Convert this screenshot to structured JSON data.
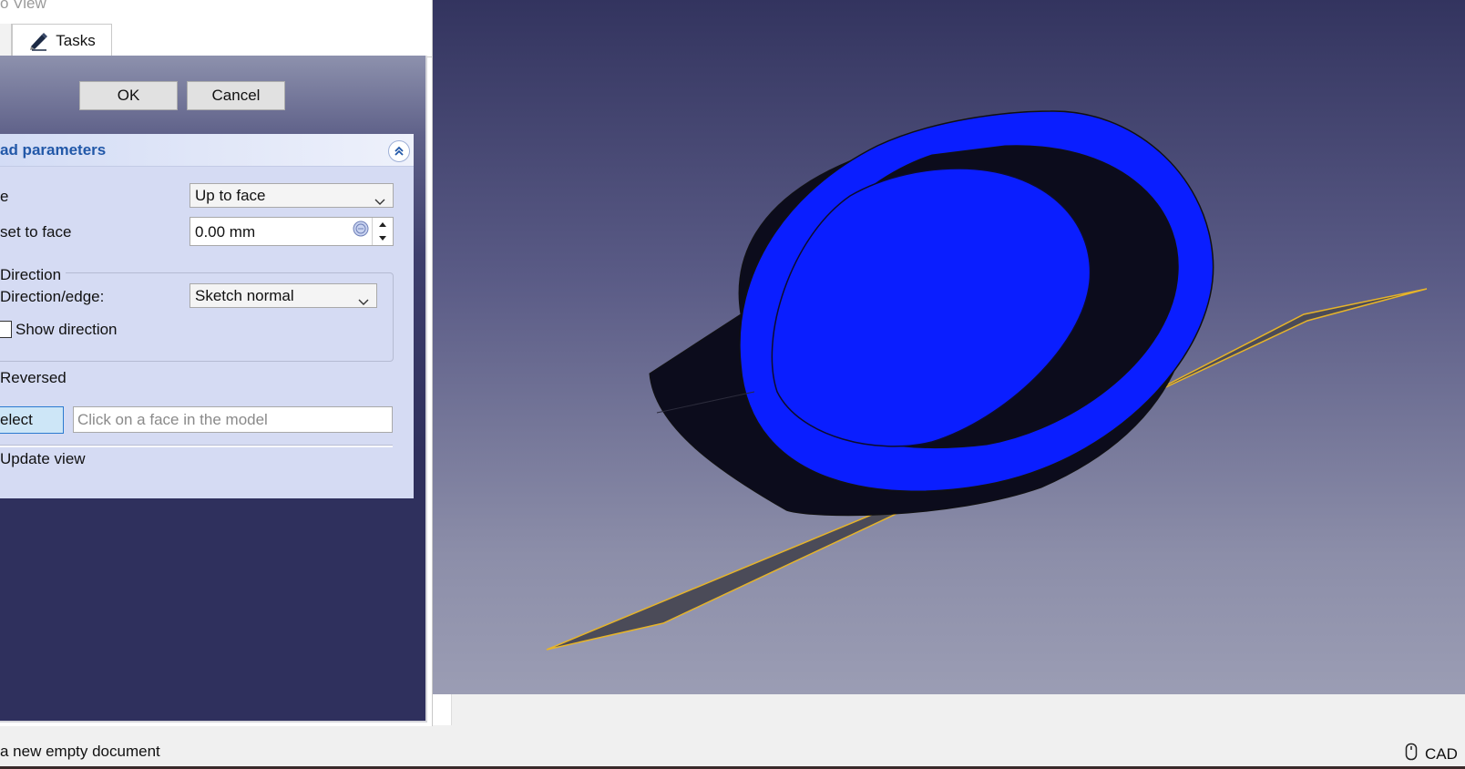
{
  "combo": {
    "title_partial": "o View",
    "tabs": [
      {
        "label": "Tasks",
        "icon": "pencil-icon"
      }
    ]
  },
  "task": {
    "ok_label": "OK",
    "cancel_label": "Cancel",
    "section_title": "ad parameters",
    "type_label": "e",
    "type_value": "Up to face",
    "offset_label": "set to face",
    "offset_value": "0.00 mm",
    "direction_group": "Direction",
    "direction_edge_label": "Direction/edge:",
    "direction_edge_value": "Sketch normal",
    "show_direction_label": "Show direction",
    "reversed_label": "Reversed",
    "select_face_label": "elect face",
    "face_placeholder": "Click on a face in the model",
    "update_view_label": "Update view"
  },
  "status": {
    "message": "a new empty document",
    "nav_style": "CAD",
    "nav_icon": "mouse-icon"
  },
  "colors": {
    "solid_blue": "#0a1eff",
    "solid_dark": "#0c0c1c",
    "plane_edge": "#e6b42a",
    "plane_fill": "#4b4b58",
    "section_title": "#2258a8"
  }
}
